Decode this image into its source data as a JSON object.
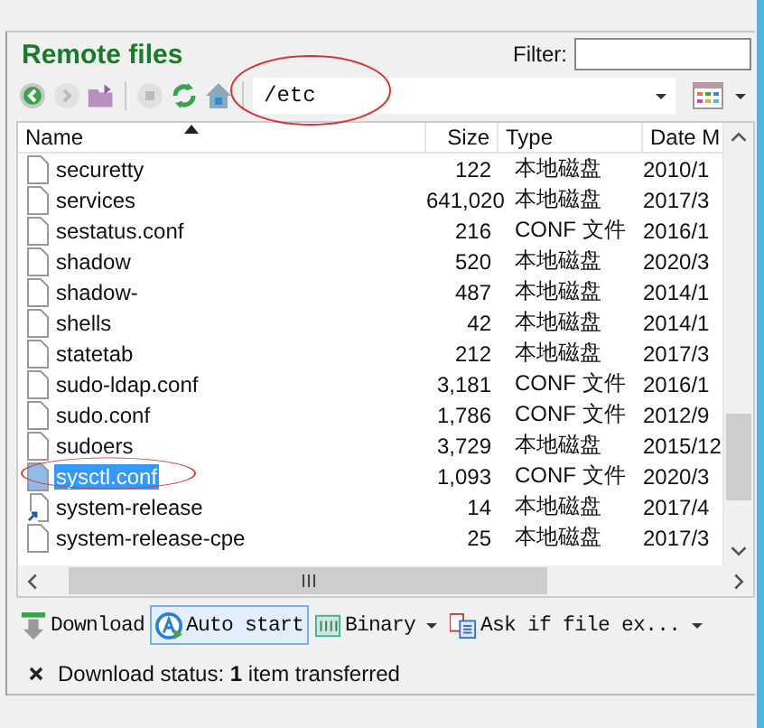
{
  "panel": {
    "title": "Remote files",
    "filter_label": "Filter:"
  },
  "path": "/etc",
  "columns": [
    {
      "label": "Name",
      "sorted": true
    },
    {
      "label": "Size",
      "sorted": false
    },
    {
      "label": "Type",
      "sorted": false
    },
    {
      "label": "Date M",
      "sorted": false
    }
  ],
  "rows": [
    {
      "name": "securetty",
      "size": "122",
      "type": "本地磁盘",
      "date": "2010/1",
      "kind": "file",
      "selected": false
    },
    {
      "name": "services",
      "size": "641,020",
      "type": "本地磁盘",
      "date": "2017/3",
      "kind": "file",
      "selected": false
    },
    {
      "name": "sestatus.conf",
      "size": "216",
      "type": "CONF 文件",
      "date": "2016/1",
      "kind": "file",
      "selected": false
    },
    {
      "name": "shadow",
      "size": "520",
      "type": "本地磁盘",
      "date": "2020/3",
      "kind": "file",
      "selected": false
    },
    {
      "name": "shadow-",
      "size": "487",
      "type": "本地磁盘",
      "date": "2014/1",
      "kind": "file",
      "selected": false
    },
    {
      "name": "shells",
      "size": "42",
      "type": "本地磁盘",
      "date": "2014/1",
      "kind": "file",
      "selected": false
    },
    {
      "name": "statetab",
      "size": "212",
      "type": "本地磁盘",
      "date": "2017/3",
      "kind": "file",
      "selected": false
    },
    {
      "name": "sudo-ldap.conf",
      "size": "3,181",
      "type": "CONF 文件",
      "date": "2016/1",
      "kind": "file",
      "selected": false
    },
    {
      "name": "sudo.conf",
      "size": "1,786",
      "type": "CONF 文件",
      "date": "2012/9",
      "kind": "file",
      "selected": false
    },
    {
      "name": "sudoers",
      "size": "3,729",
      "type": "本地磁盘",
      "date": "2015/12",
      "kind": "file",
      "selected": false
    },
    {
      "name": "sysctl.conf",
      "size": "1,093",
      "type": "CONF 文件",
      "date": "2020/3",
      "kind": "file",
      "selected": true
    },
    {
      "name": "system-release",
      "size": "14",
      "type": "本地磁盘",
      "date": "2017/4",
      "kind": "link",
      "selected": false
    },
    {
      "name": "system-release-cpe",
      "size": "25",
      "type": "本地磁盘",
      "date": "2017/3",
      "kind": "file",
      "selected": false
    }
  ],
  "buttons": [
    {
      "label": "Download",
      "kind": "download",
      "pressed": false,
      "dropdown": false
    },
    {
      "label": "Auto start",
      "kind": "auto",
      "pressed": true,
      "dropdown": false
    },
    {
      "label": "Binary",
      "kind": "binary",
      "pressed": false,
      "dropdown": true
    },
    {
      "label": "Ask if file ex...",
      "kind": "ask",
      "pressed": false,
      "dropdown": true
    }
  ],
  "status": "Download status: **1** item transferred"
}
